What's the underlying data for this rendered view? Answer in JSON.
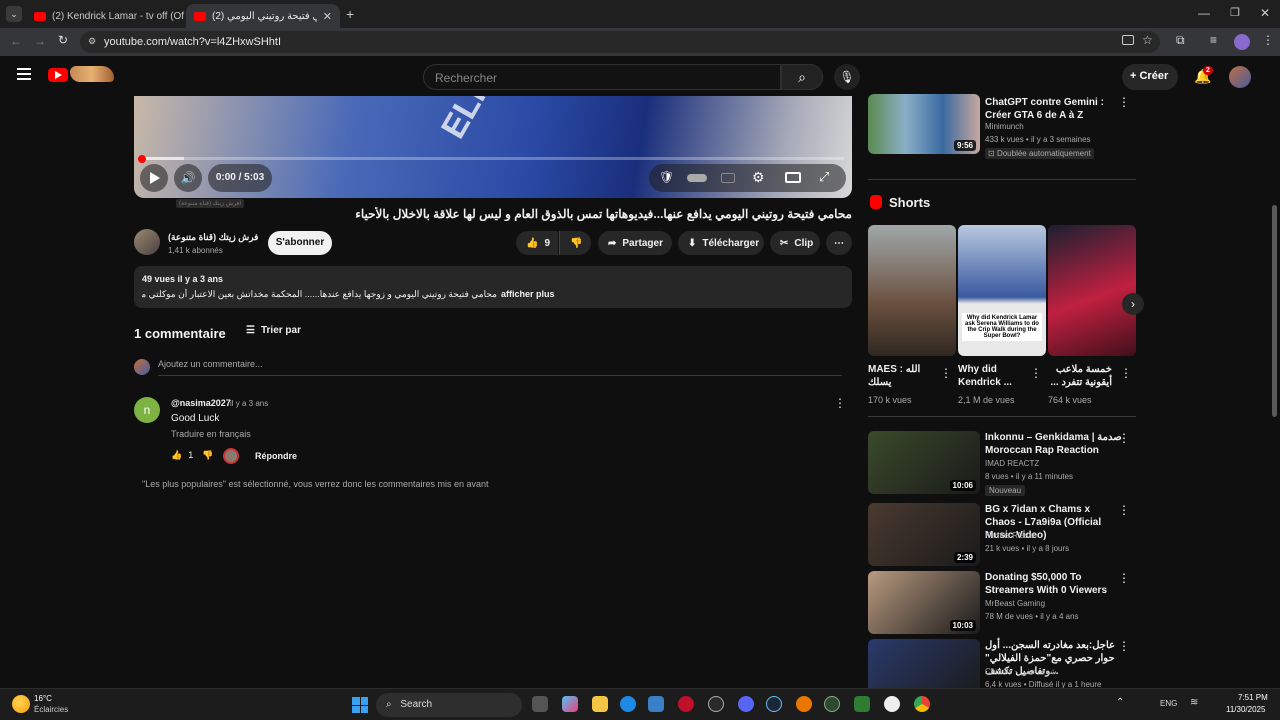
{
  "browser": {
    "tabs": [
      {
        "title": "(2) Kendrick Lamar - tv off (Offi"
      },
      {
        "title": "(2) محامي فتيحة روتيني اليومي ..."
      }
    ],
    "url": "youtube.com/watch?v=l4ZHxwSHhtI"
  },
  "youtube": {
    "search_placeholder": "Rechercher",
    "create_label": "Créer",
    "notif_count": "2"
  },
  "player": {
    "time": "0:00 / 5:03",
    "overlay_text": "ELHada"
  },
  "video": {
    "title": "محامي فتيحة روتيني اليومي يدافع عنها...فيديوهاتها تمس بالذوق العام و ليس لها علاقة بالاخلال بالأحياء",
    "channel": "افرش زيتك (قناة متنوعة)",
    "subs": "1,41 k abonnés",
    "tooltip": "افرش زيتك (قناة متنوعة)",
    "subscribe": "S'abonner",
    "likes": "9",
    "share": "Partager",
    "download": "Télécharger",
    "clip": "Clip"
  },
  "description": {
    "stats": "49 vues  il y a 3 ans",
    "text": "محامي فتيحة روتيني اليومي و زوجها يدافع عندها...... المحكمة مخداتش بعين الاعتبار أن موكلتي مريضة مرض نفسي ...",
    "more": "afficher plus"
  },
  "comments": {
    "count": "1 commentaire",
    "sort": "Trier par",
    "add": "Ajoutez un commentaire...",
    "items": [
      {
        "author": "@nasima2027",
        "time": "il y a 3 ans",
        "text": "Good Luck",
        "translate": "Traduire en français",
        "likes": "1",
        "reply": "Répondre"
      }
    ],
    "footer": "\"Les plus populaires\" est sélectionné, vous verrez donc les commentaires mis en avant"
  },
  "sidebar": {
    "top": {
      "title": "ChatGPT contre Gemini : Créer GTA 6 de A à Z",
      "channel": "Minimunch",
      "meta": "433 k vues • il y a 3 semaines",
      "badge": "Doublée automatiquement",
      "duration": "9:56"
    },
    "shorts_label": "Shorts",
    "shorts": [
      {
        "title": "MAES : الله يسلك",
        "views": "170 k vues"
      },
      {
        "title": "Why did Kendrick ...",
        "views": "2,1 M de vues",
        "overlay": "Why did Kendrick Lamar ask Serena Williams to do the Crip Walk during the Super Bowl?"
      },
      {
        "title": "خمسة ملاعب أيقونية تتفرد ...",
        "views": "764 k vues"
      }
    ],
    "videos": [
      {
        "title": "Inkonnu – Genkidama | صدمة Moroccan Rap Reaction",
        "channel": "IMAD REACTZ",
        "meta": "8 vues • il y a 11 minutes",
        "badge": "Nouveau",
        "duration": "10:06",
        "color": "#3a4a2a"
      },
      {
        "title": "BG x 7idan x Chams x Chaos - L7a9i9a (Official Music Video)",
        "channel": "Khmas Rfasa",
        "meta": "21 k vues • il y a 8 jours",
        "duration": "2:39",
        "color": "#4a3a30"
      },
      {
        "title": "Donating $50,000 To Streamers With 0 Viewers",
        "channel": "MrBeast Gaming",
        "meta": "78 M de vues • il y a 4 ans",
        "duration": "10:03",
        "color": "#b89a80"
      },
      {
        "title": "عاجل:بعد مغادرته السجن... أول حوار حصري مع\"حمزة الفيلالي\" وتفاصيل تكشف...",
        "channel": "Chouftv - شوف تيفي",
        "meta": "6,4 k vues • Diffusé il y a 1 heure",
        "color": "#2a3a6a"
      }
    ]
  },
  "taskbar": {
    "temp": "16°C",
    "weather": "Éclaircies",
    "search": "Search",
    "lang": "ENG",
    "time": "7:51 PM",
    "date": "11/30/2025"
  }
}
